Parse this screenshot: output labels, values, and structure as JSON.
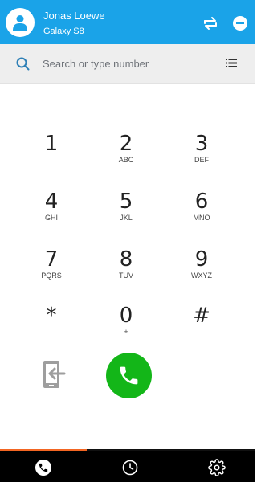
{
  "header": {
    "contact_name": "Jonas Loewe",
    "device_name": "Galaxy S8",
    "background_color": "#1aa3e8"
  },
  "search": {
    "placeholder": "Search or type number"
  },
  "keypad": {
    "keys": [
      {
        "digit": "1",
        "letters": ""
      },
      {
        "digit": "2",
        "letters": "ABC"
      },
      {
        "digit": "3",
        "letters": "DEF"
      },
      {
        "digit": "4",
        "letters": "GHI"
      },
      {
        "digit": "5",
        "letters": "JKL"
      },
      {
        "digit": "6",
        "letters": "MNO"
      },
      {
        "digit": "7",
        "letters": "PQRS"
      },
      {
        "digit": "8",
        "letters": "TUV"
      },
      {
        "digit": "9",
        "letters": "WXYZ"
      },
      {
        "digit": "*",
        "letters": ""
      },
      {
        "digit": "0",
        "letters": "+"
      },
      {
        "digit": "#",
        "letters": ""
      }
    ]
  },
  "actions": {
    "transfer_icon": "phone-transfer-icon",
    "call_icon": "phone-icon",
    "call_color": "#13b618"
  },
  "progress": {
    "fraction": 0.34,
    "color": "#f26522"
  },
  "bottom_nav": {
    "items": [
      {
        "icon": "phone-icon",
        "active": true
      },
      {
        "icon": "clock-icon",
        "active": false
      },
      {
        "icon": "gear-icon",
        "active": false
      }
    ]
  }
}
